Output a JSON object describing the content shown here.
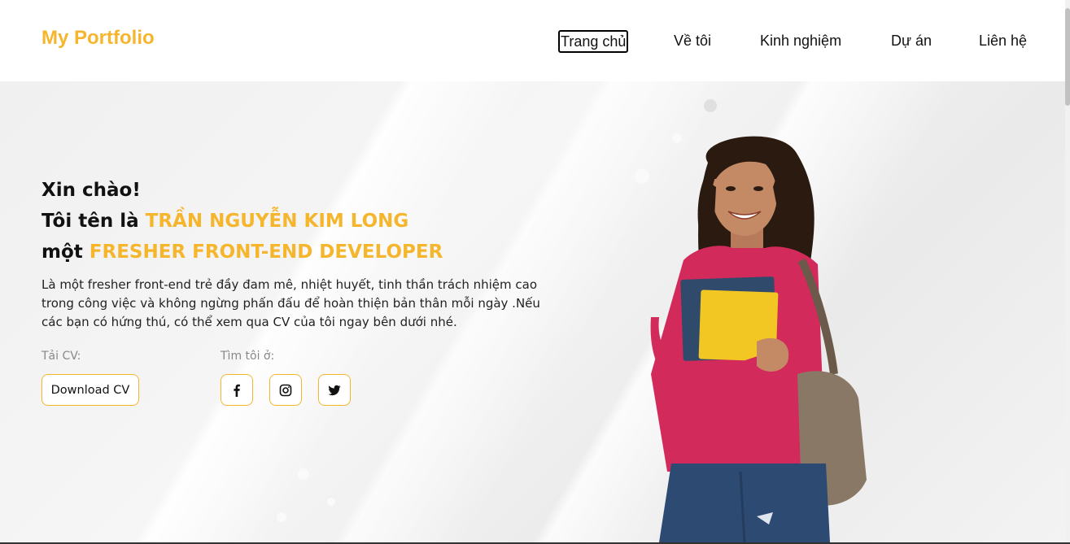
{
  "header": {
    "logo": "My Portfolio",
    "nav": [
      {
        "label": "Trang chủ",
        "active": true
      },
      {
        "label": "Về tôi",
        "active": false
      },
      {
        "label": "Kinh nghiệm",
        "active": false
      },
      {
        "label": "Dự án",
        "active": false
      },
      {
        "label": "Liên hệ",
        "active": false
      }
    ]
  },
  "hero": {
    "greeting": "Xin chào!",
    "name_prefix": "Tôi tên là ",
    "name": "TRẦN NGUYỄN KIM LONG",
    "role_prefix": "một ",
    "role": "FRESHER FRONT-END DEVELOPER",
    "description": "Là một fresher front-end trẻ đầy đam mê, nhiệt huyết, tinh thần trách nhiệm cao trong công việc và không ngừng phấn đấu để hoàn thiện bản thân mỗi ngày .Nếu các bạn có hứng thú, có thể xem qua CV của tôi ngay bên dưới nhé.",
    "cv_label": "Tải CV:",
    "download_label": "Download CV",
    "find_label": "Tìm tôi ở:",
    "socials": [
      "facebook-icon",
      "instagram-icon",
      "twitter-icon"
    ]
  },
  "colors": {
    "accent": "#f5b62d",
    "text": "#111111"
  }
}
